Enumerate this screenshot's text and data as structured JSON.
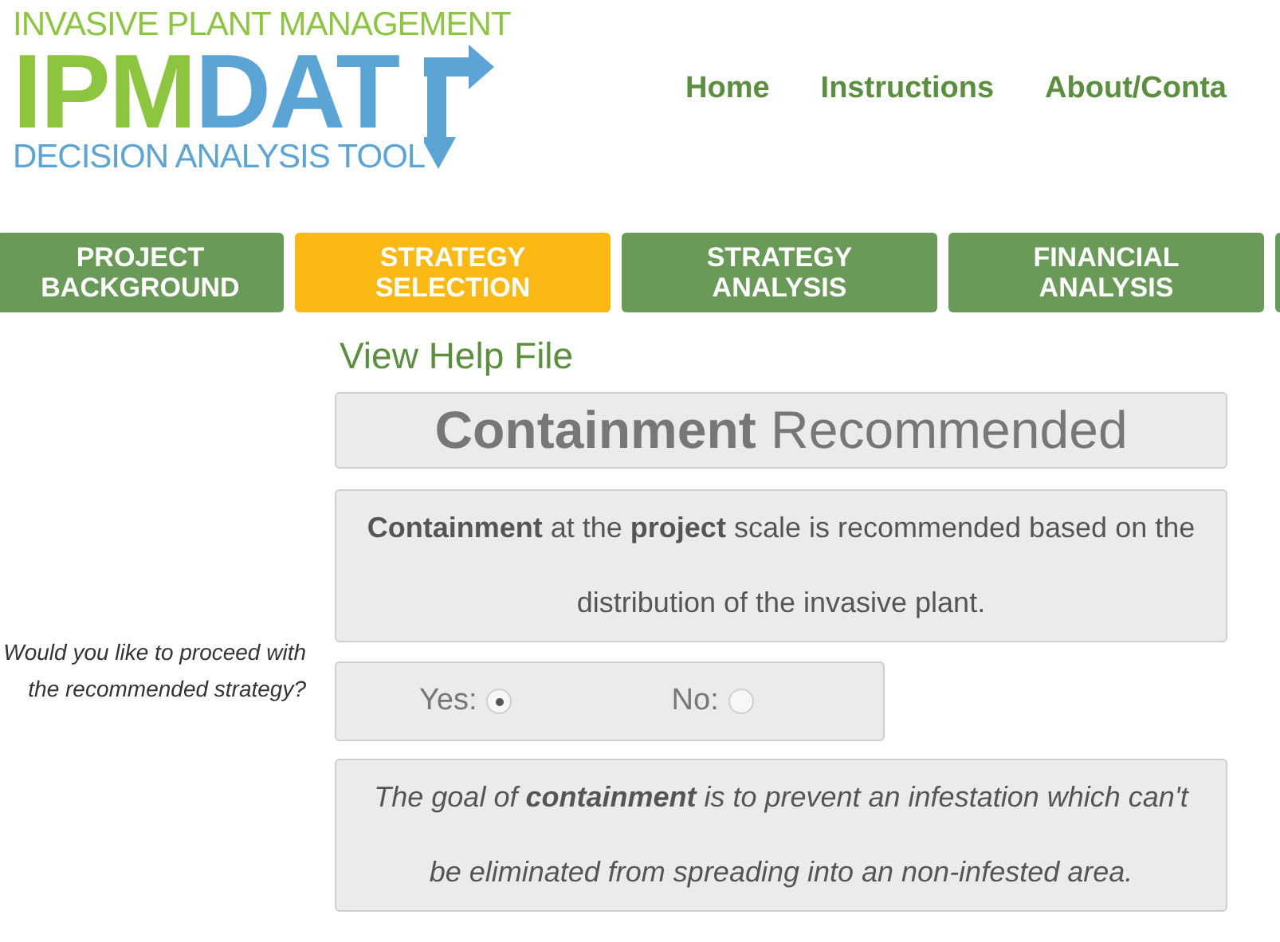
{
  "logo": {
    "tagline_top": "INVASIVE PLANT MANAGEMENT",
    "mark_green": "IPM",
    "mark_blue": "DAT",
    "tagline_bottom": "DECISION ANALYSIS TOOL"
  },
  "nav_links": [
    "Home",
    "Instructions",
    "About/Conta"
  ],
  "tabs": [
    {
      "label": "PROJECT BACKGROUND",
      "selected": false
    },
    {
      "label": "STRATEGY SELECTION",
      "selected": true
    },
    {
      "label": "STRATEGY ANALYSIS",
      "selected": false
    },
    {
      "label": "FINANCIAL ANALYSIS",
      "selected": false
    }
  ],
  "help_link": "View Help File",
  "recommendation_title": "**Containment** Recommended",
  "recommendation_text": "**Containment** at the **project** scale is recommended based on the distribution of the invasive plant.",
  "question": "Would you like to proceed with the recommended strategy?",
  "options": [
    {
      "label": "Yes:",
      "selected": true
    },
    {
      "label": "No:",
      "selected": false
    }
  ],
  "goal_text": "The goal of **containment** is to prevent an infestation which can't be eliminated from spreading into an non-infested area."
}
